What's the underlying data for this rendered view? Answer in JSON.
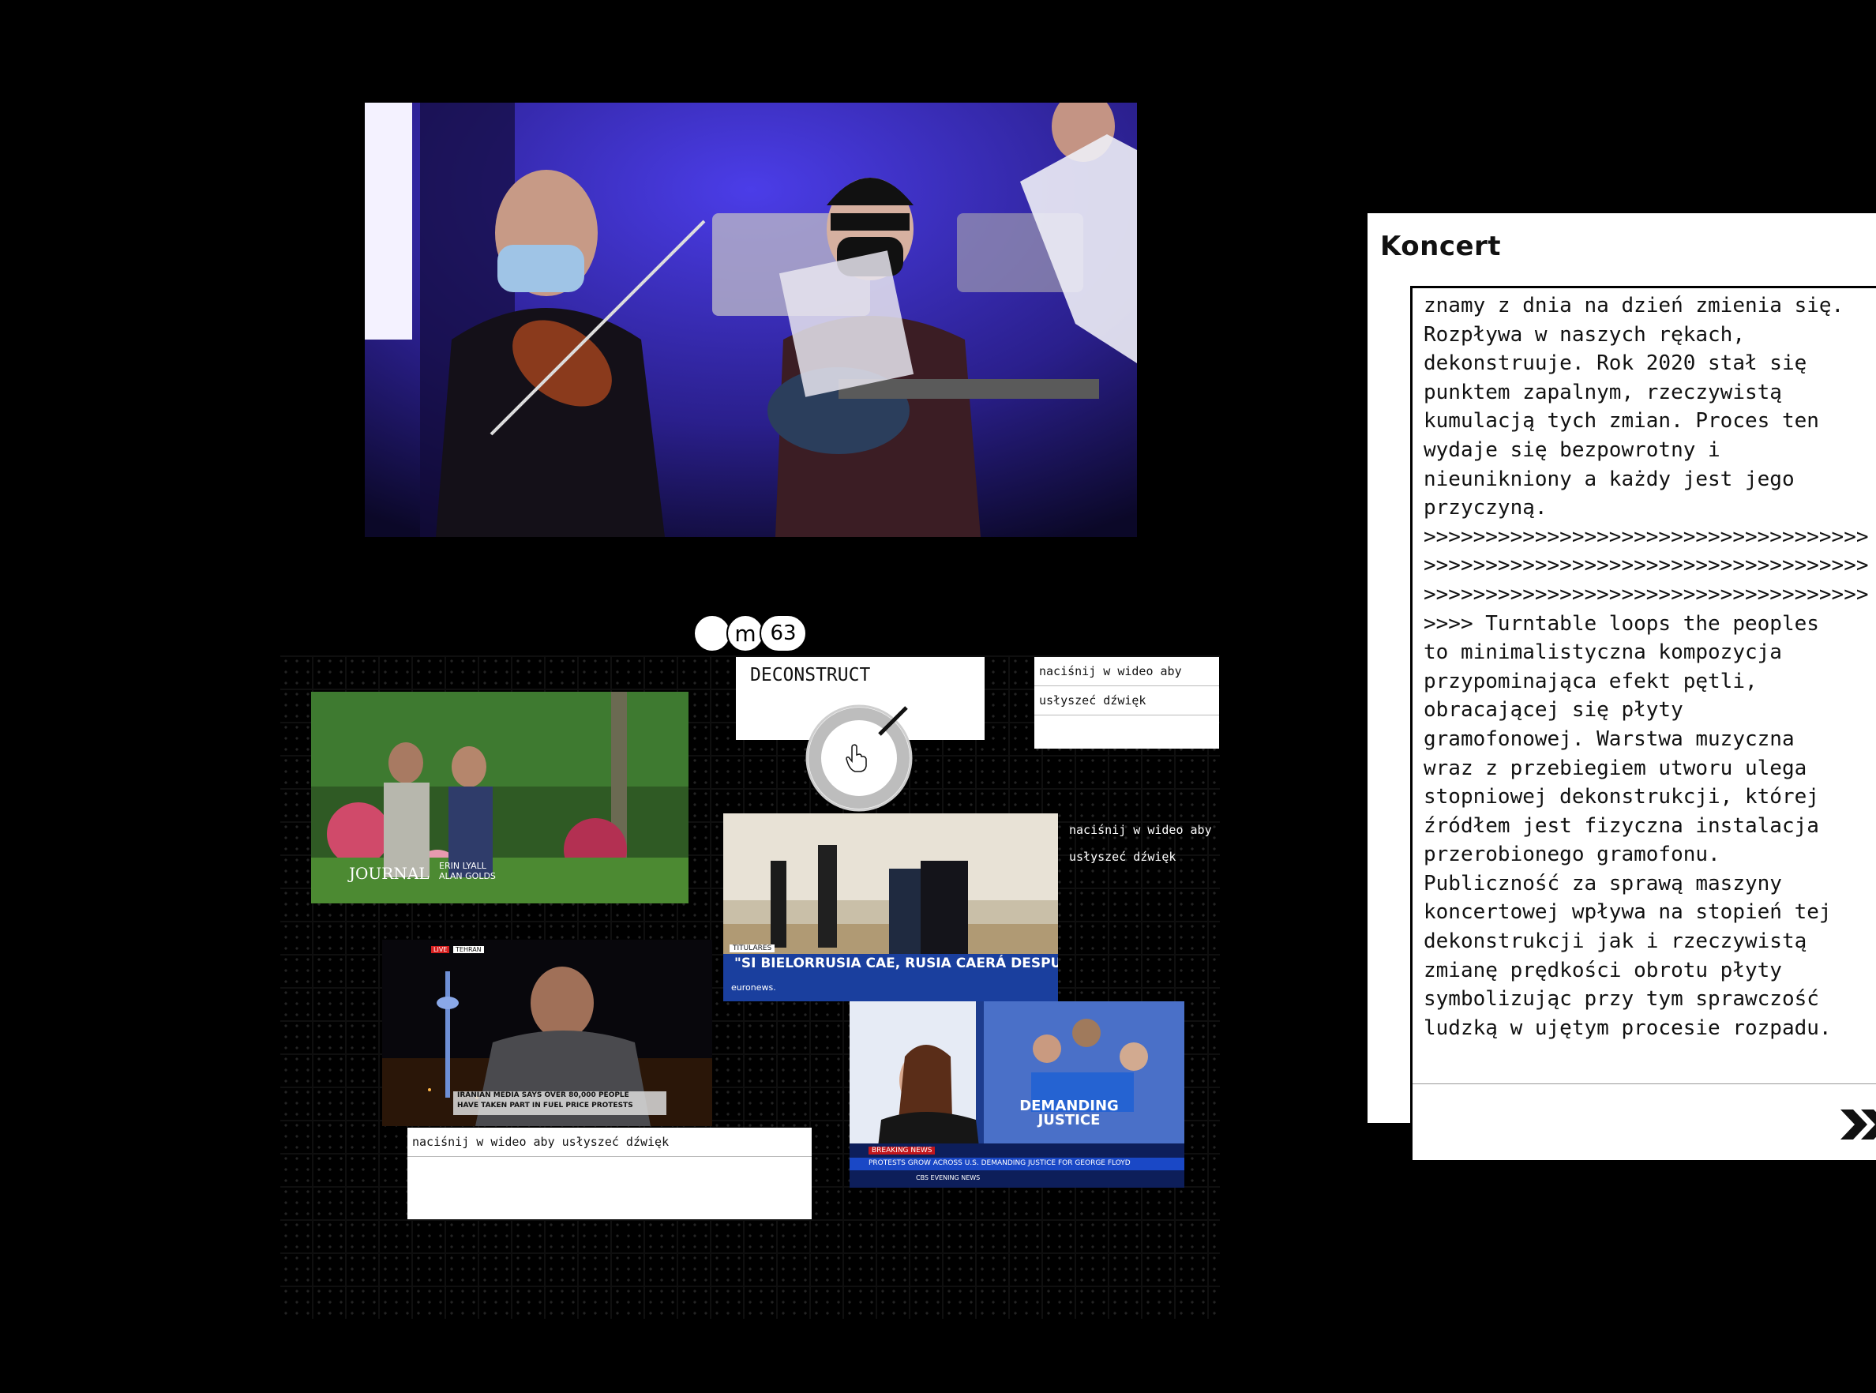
{
  "logo": {
    "parts": [
      "",
      "m",
      "63"
    ]
  },
  "knob_widget": {
    "title": "DECONSTRUCT"
  },
  "captions": {
    "top_right_line1": "naciśnij w wideo aby",
    "top_right_line2": "usłyszeć dźwięk",
    "middle_right_line1": "naciśnij w wideo aby",
    "middle_right_line2": "usłyszeć dźwięk",
    "bottom": "naciśnij w wideo aby usłyszeć dźwięk"
  },
  "videos": {
    "journal": {
      "brand": "JOURNAL",
      "names": "ERIN LYALL\nALAN GOLDS"
    },
    "aljazeera": {
      "live": "LIVE",
      "city": "TEHRAN",
      "headline1": "IRANIAN MEDIA SAYS OVER 80,000 PEOPLE",
      "headline2": "HAVE TAKEN PART IN FUEL PRICE PROTESTS"
    },
    "euronews": {
      "tag": "TITULARES",
      "headline": "\"SI BIELORRUSIA CAE, RUSIA CAERÁ DESPUÉS\"",
      "brand": "euronews."
    },
    "cbs": {
      "breaking": "BREAKING NEWS",
      "ticker": "PROTESTS GROW ACROSS U.S. DEMANDING JUSTICE FOR GEORGE FLOYD",
      "show": "CBS EVENING NEWS",
      "sign": "DEMANDING JUSTICE"
    }
  },
  "panel": {
    "title": "Koncert",
    "body": "znamy z dnia na dzień zmienia się.\nRozpływa w naszych rękach,\ndekonstruuje. Rok 2020 stał się\npunktem zapalnym, rzeczywistą\nkumulacją tych zmian. Proces ten\nwydaje się bezpowrotny i\nnieunikniony a każdy jest jego\nprzyczyną.\n>>>>>>>>>>>>>>>>>>>>>>>>>>>>>>>>>>>>\n>>>>>>>>>>>>>>>>>>>>>>>>>>>>>>>>>>>>\n>>>>>>>>>>>>>>>>>>>>>>>>>>>>>>>>>>>>\n>>>> Turntable loops the peoples\nto minimalistyczna kompozycja\nprzypominająca efekt pętli,\nobracającej się płyty\ngramofonowej. Warstwa muzyczna\nwraz z przebiegiem utworu ulega\nstopniowej dekonstrukcji, której\nźródłem jest fizyczna instalacja\nprzerobionego gramofonu.\nPubliczność za sprawą maszyny\nkoncertowej wpływa na stopień tej\ndekonstrukcji jak i rzeczywistą\nzmianę prędkości obrotu płyty\nsymbolizując przy tym sprawczość\nludzką w ujętym procesie rozpadu.",
    "next_icon": "double-chevron-right-icon"
  },
  "colors": {
    "background": "#000000",
    "panel": "#ffffff",
    "stage_light": "#3a2fd0"
  }
}
